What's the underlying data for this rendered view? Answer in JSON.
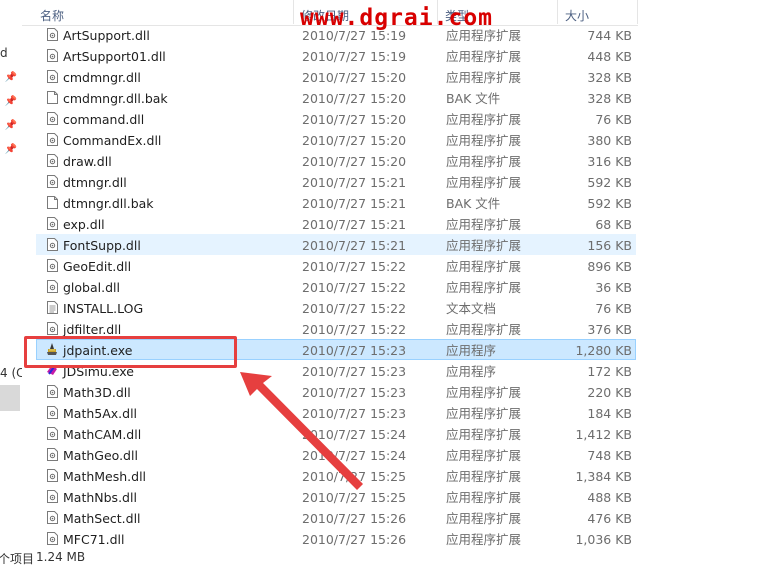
{
  "left_pane": {
    "frag_top": "d",
    "frag_mid": "4 (C",
    "pin_icon": "pin-icon"
  },
  "columns": {
    "name": "名称",
    "date": "修改日期",
    "type": "类型",
    "size": "大小"
  },
  "watermark": "www.dgrai.com",
  "files": [
    {
      "name": "ArtSupport.dll",
      "date": "2010/7/27 15:19",
      "type": "应用程序扩展",
      "size": "744 KB",
      "icon": "dll"
    },
    {
      "name": "ArtSupport01.dll",
      "date": "2010/7/27 15:19",
      "type": "应用程序扩展",
      "size": "448 KB",
      "icon": "dll"
    },
    {
      "name": "cmdmngr.dll",
      "date": "2010/7/27 15:20",
      "type": "应用程序扩展",
      "size": "328 KB",
      "icon": "dll"
    },
    {
      "name": "cmdmngr.dll.bak",
      "date": "2010/7/27 15:20",
      "type": "BAK 文件",
      "size": "328 KB",
      "icon": "blank"
    },
    {
      "name": "command.dll",
      "date": "2010/7/27 15:20",
      "type": "应用程序扩展",
      "size": "76 KB",
      "icon": "dll"
    },
    {
      "name": "CommandEx.dll",
      "date": "2010/7/27 15:20",
      "type": "应用程序扩展",
      "size": "380 KB",
      "icon": "dll"
    },
    {
      "name": "draw.dll",
      "date": "2010/7/27 15:20",
      "type": "应用程序扩展",
      "size": "316 KB",
      "icon": "dll"
    },
    {
      "name": "dtmngr.dll",
      "date": "2010/7/27 15:21",
      "type": "应用程序扩展",
      "size": "592 KB",
      "icon": "dll"
    },
    {
      "name": "dtmngr.dll.bak",
      "date": "2010/7/27 15:21",
      "type": "BAK 文件",
      "size": "592 KB",
      "icon": "blank"
    },
    {
      "name": "exp.dll",
      "date": "2010/7/27 15:21",
      "type": "应用程序扩展",
      "size": "68 KB",
      "icon": "dll"
    },
    {
      "name": "FontSupp.dll",
      "date": "2010/7/27 15:21",
      "type": "应用程序扩展",
      "size": "156 KB",
      "icon": "dll",
      "state": "hover"
    },
    {
      "name": "GeoEdit.dll",
      "date": "2010/7/27 15:22",
      "type": "应用程序扩展",
      "size": "896 KB",
      "icon": "dll"
    },
    {
      "name": "global.dll",
      "date": "2010/7/27 15:22",
      "type": "应用程序扩展",
      "size": "36 KB",
      "icon": "dll"
    },
    {
      "name": "INSTALL.LOG",
      "date": "2010/7/27 15:22",
      "type": "文本文档",
      "size": "76 KB",
      "icon": "text"
    },
    {
      "name": "jdfilter.dll",
      "date": "2010/7/27 15:22",
      "type": "应用程序扩展",
      "size": "376 KB",
      "icon": "dll"
    },
    {
      "name": "jdpaint.exe",
      "date": "2010/7/27 15:23",
      "type": "应用程序",
      "size": "1,280 KB",
      "icon": "jdpaint",
      "state": "selected"
    },
    {
      "name": "JDSimu.exe",
      "date": "2010/7/27 15:23",
      "type": "应用程序",
      "size": "172 KB",
      "icon": "simu"
    },
    {
      "name": "Math3D.dll",
      "date": "2010/7/27 15:23",
      "type": "应用程序扩展",
      "size": "220 KB",
      "icon": "dll"
    },
    {
      "name": "Math5Ax.dll",
      "date": "2010/7/27 15:23",
      "type": "应用程序扩展",
      "size": "184 KB",
      "icon": "dll"
    },
    {
      "name": "MathCAM.dll",
      "date": "2010/7/27 15:24",
      "type": "应用程序扩展",
      "size": "1,412 KB",
      "icon": "dll"
    },
    {
      "name": "MathGeo.dll",
      "date": "2010/7/27 15:24",
      "type": "应用程序扩展",
      "size": "748 KB",
      "icon": "dll"
    },
    {
      "name": "MathMesh.dll",
      "date": "2010/7/27 15:25",
      "type": "应用程序扩展",
      "size": "1,384 KB",
      "icon": "dll"
    },
    {
      "name": "MathNbs.dll",
      "date": "2010/7/27 15:25",
      "type": "应用程序扩展",
      "size": "488 KB",
      "icon": "dll"
    },
    {
      "name": "MathSect.dll",
      "date": "2010/7/27 15:26",
      "type": "应用程序扩展",
      "size": "476 KB",
      "icon": "dll"
    },
    {
      "name": "MFC71.dll",
      "date": "2010/7/27 15:26",
      "type": "应用程序扩展",
      "size": "1,036 KB",
      "icon": "dll"
    }
  ],
  "status": {
    "items_fragment": "个项目",
    "selected_size": "1.24 MB"
  },
  "annotation": {
    "color": "#e63f3f"
  }
}
